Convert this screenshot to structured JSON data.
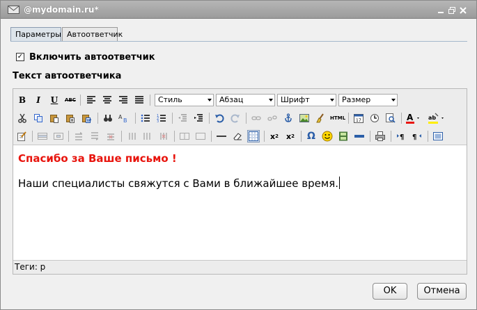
{
  "window": {
    "title": "@mydomain.ru*"
  },
  "tabs": [
    {
      "label": "Параметры",
      "active": true
    },
    {
      "label": "Автоответчик",
      "active": false
    }
  ],
  "autoreply": {
    "enable_label": "Включить автоответчик",
    "checked": true
  },
  "editor": {
    "section_title": "Текст автоответчика",
    "toolbar": {
      "style_label": "Стиль",
      "paragraph_label": "Абзац",
      "font_label": "Шрифт",
      "size_label": "Размер",
      "html_label": "HTML",
      "abc_label": "ABC"
    },
    "content": {
      "heading": "Спасибо за Ваше письмо !",
      "body": "Наши специалисты свяжутся с Вами в ближайшее время."
    },
    "status": "Теги: p"
  },
  "buttons": {
    "ok": "OK",
    "cancel": "Отмена"
  },
  "colors": {
    "heading_red": "#e8140d",
    "titlebar": "#a9a9a9",
    "accent_blue": "#2b5ea8"
  }
}
